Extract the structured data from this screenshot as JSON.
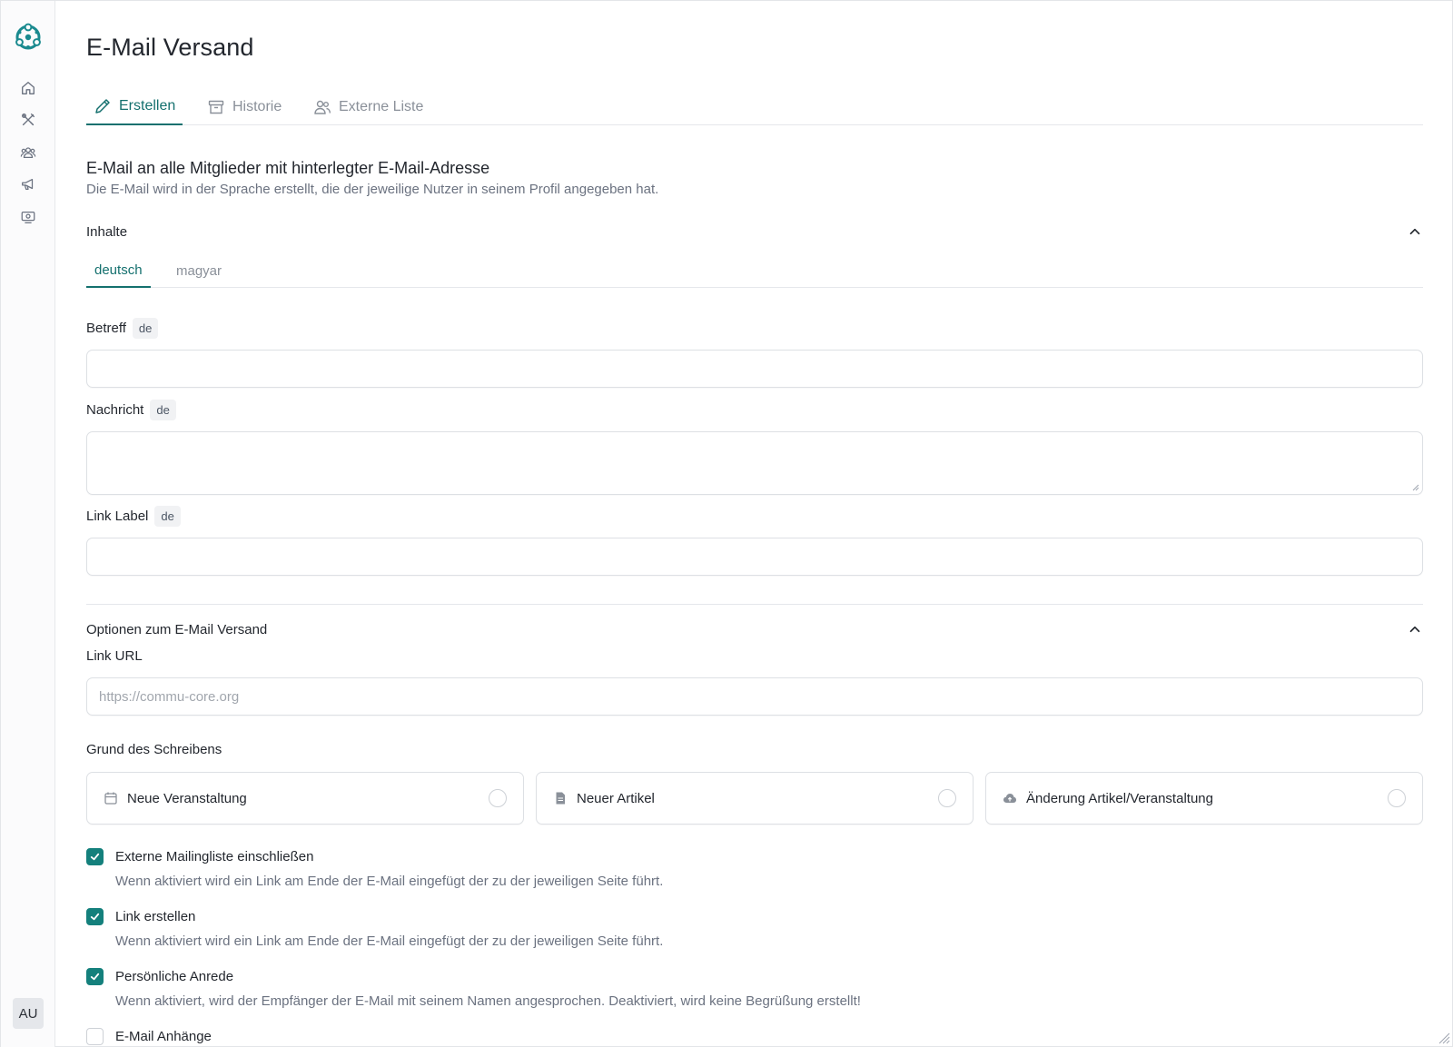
{
  "page": {
    "title": "E-Mail Versand"
  },
  "sidebar": {
    "logo_icon": "commu-core-logo-icon",
    "items": [
      {
        "icon": "home-icon"
      },
      {
        "icon": "tools-icon"
      },
      {
        "icon": "users-icon"
      },
      {
        "icon": "megaphone-icon"
      },
      {
        "icon": "payment-icon"
      }
    ],
    "avatar": "AU"
  },
  "tabs": [
    {
      "label": "Erstellen",
      "icon": "pencil-icon",
      "active": true
    },
    {
      "label": "Historie",
      "icon": "archive-icon",
      "active": false
    },
    {
      "label": "Externe Liste",
      "icon": "users-icon",
      "active": false
    }
  ],
  "intro": {
    "heading": "E-Mail an alle Mitglieder mit hinterlegter E-Mail-Adresse",
    "subtext": "Die E-Mail wird in der Sprache erstellt, die der jeweilige Nutzer in seinem Profil angegeben hat."
  },
  "contents": {
    "title": "Inhalte",
    "lang_tabs": [
      {
        "label": "deutsch",
        "active": true
      },
      {
        "label": "magyar",
        "active": false
      }
    ],
    "fields": {
      "subject": {
        "label": "Betreff",
        "lang": "de",
        "value": ""
      },
      "message": {
        "label": "Nachricht",
        "lang": "de",
        "value": ""
      },
      "link_label": {
        "label": "Link Label",
        "lang": "de",
        "value": ""
      }
    }
  },
  "options": {
    "title": "Optionen zum E-Mail Versand",
    "link_url": {
      "label": "Link URL",
      "placeholder": "https://commu-core.org",
      "value": ""
    },
    "reason": {
      "label": "Grund des Schreibens",
      "choices": [
        {
          "label": "Neue Veranstaltung",
          "icon": "calendar-icon",
          "selected": false
        },
        {
          "label": "Neuer Artikel",
          "icon": "document-icon",
          "selected": false
        },
        {
          "label": "Änderung Artikel/Veranstaltung",
          "icon": "cloud-upload-icon",
          "selected": false
        }
      ]
    },
    "checkboxes": [
      {
        "label": "Externe Mailingliste einschließen",
        "checked": true,
        "description": "Wenn aktiviert wird ein Link am Ende der E-Mail eingefügt der zu der jeweiligen Seite führt."
      },
      {
        "label": "Link erstellen",
        "checked": true,
        "description": "Wenn aktiviert wird ein Link am Ende der E-Mail eingefügt der zu der jeweiligen Seite führt."
      },
      {
        "label": "Persönliche Anrede",
        "checked": true,
        "description": "Wenn aktiviert, wird der Empfänger der E-Mail mit seinem Namen angesprochen. Deaktiviert, wird keine Begrüßung erstellt!"
      },
      {
        "label": "E-Mail Anhänge",
        "checked": false,
        "description": ""
      }
    ]
  },
  "colors": {
    "accent": "#14706e",
    "checkbox": "#14807c",
    "muted_text": "#6b7280",
    "border": "#dde0e4"
  }
}
